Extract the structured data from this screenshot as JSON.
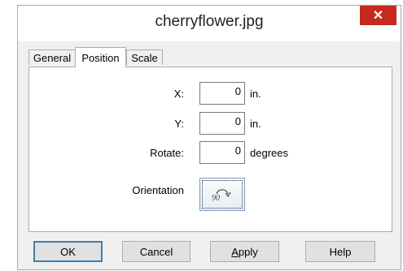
{
  "window": {
    "title": "cherryflower.jpg",
    "close_glyph": "✕"
  },
  "tabs": [
    {
      "label": "General"
    },
    {
      "label": "Position",
      "active": true
    },
    {
      "label": "Scale"
    }
  ],
  "position": {
    "x": {
      "label": "X:",
      "value": "0",
      "unit": "in."
    },
    "y": {
      "label": "Y:",
      "value": "0",
      "unit": "in."
    },
    "rotate": {
      "label": "Rotate:",
      "value": "0",
      "unit": "degrees"
    },
    "orientation": {
      "label": "Orientation",
      "button_text": "90"
    }
  },
  "buttons": {
    "ok": "OK",
    "cancel": "Cancel",
    "apply_mnemonic": "A",
    "apply_rest": "pply",
    "help": "Help"
  },
  "colors": {
    "close": "#c42b1c",
    "default_button_border": "#3c7fb1"
  }
}
